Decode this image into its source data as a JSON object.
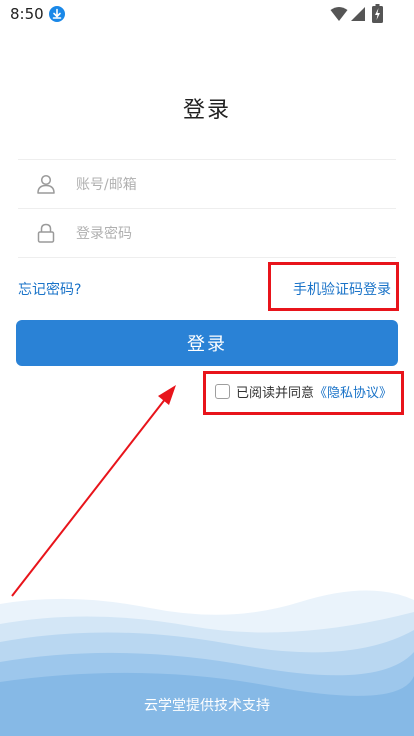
{
  "status_bar": {
    "time": "8:50"
  },
  "page": {
    "title": "登录"
  },
  "form": {
    "account_placeholder": "账号/邮箱",
    "password_placeholder": "登录密码"
  },
  "links": {
    "forgot_password": "忘记密码?",
    "sms_login": "手机验证码登录"
  },
  "buttons": {
    "login_label": "登录"
  },
  "agreement": {
    "text": "已阅读并同意",
    "privacy_link": "《隐私协议》",
    "checked": false
  },
  "footer": {
    "text": "云学堂提供技术支持"
  },
  "colors": {
    "accent": "#2a82d6",
    "link": "#1a73c8",
    "highlight": "#e8141b"
  },
  "icons": {
    "account": "user-icon",
    "password": "lock-icon"
  }
}
